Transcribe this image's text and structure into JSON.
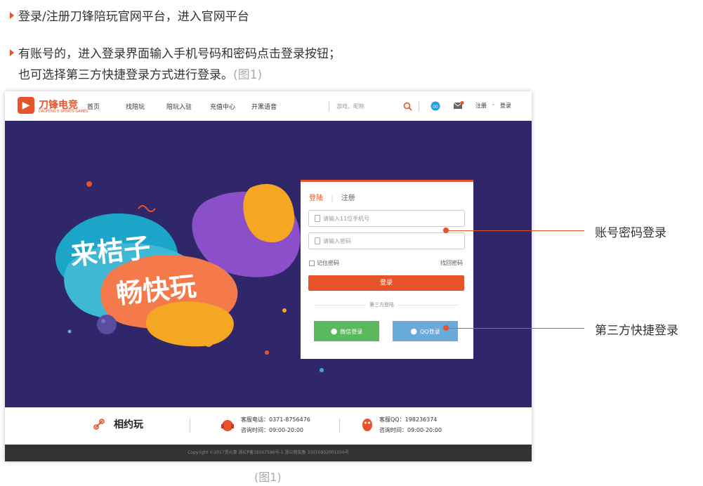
{
  "instructions": {
    "line1": "登录/注册刀锋陪玩官网平台，进入官网平台",
    "line2": "有账号的，进入登录界面输入手机号码和密码点击登录按钮；",
    "line3_main": "也可选择第三方快捷登录方式进行登录。",
    "line3_ref": "(图1)"
  },
  "site": {
    "logo_text": "刀锋电竞",
    "logo_sub": "DAOFENG E-SPORTS GAMES",
    "nav": [
      "首页",
      "找陪玩",
      "陪玩入驻",
      "充值中心",
      "开黑语音"
    ],
    "search_placeholder": "游戏、昵称",
    "register": "注册",
    "login": "登录"
  },
  "hero": {
    "slogan1": "来桔子",
    "slogan2": "畅快玩"
  },
  "login_panel": {
    "tab_login": "登陆",
    "tab_register": "注册",
    "phone_placeholder": "请输入11位手机号",
    "password_placeholder": "请输入密码",
    "remember": "记住密码",
    "forgot": "找回密码",
    "login_button": "登录",
    "third_party_label": "第三方登陆",
    "wechat_button": "微信登录",
    "qq_button": "QQ登录"
  },
  "footer": {
    "brand": "相约玩",
    "phone_label": "客服电话：0371-8756476",
    "hours1": "咨询时间：09:00-20:00",
    "qq_label": "客服QQ：198236374",
    "hours2": "咨询时间：09:00-20:00",
    "copyright": "Copyright ©2017觅元豪 浙ICP备16007586号-1 浙公网安备 33010902001056号"
  },
  "annotations": {
    "account_login": "账号密码登录",
    "third_party_login": "第三方快捷登录"
  },
  "caption": "(图1)",
  "colors": {
    "accent": "#e8542a",
    "hero_bg": "#2f2769",
    "wechat": "#5cb85c",
    "qq": "#6aaad8"
  }
}
